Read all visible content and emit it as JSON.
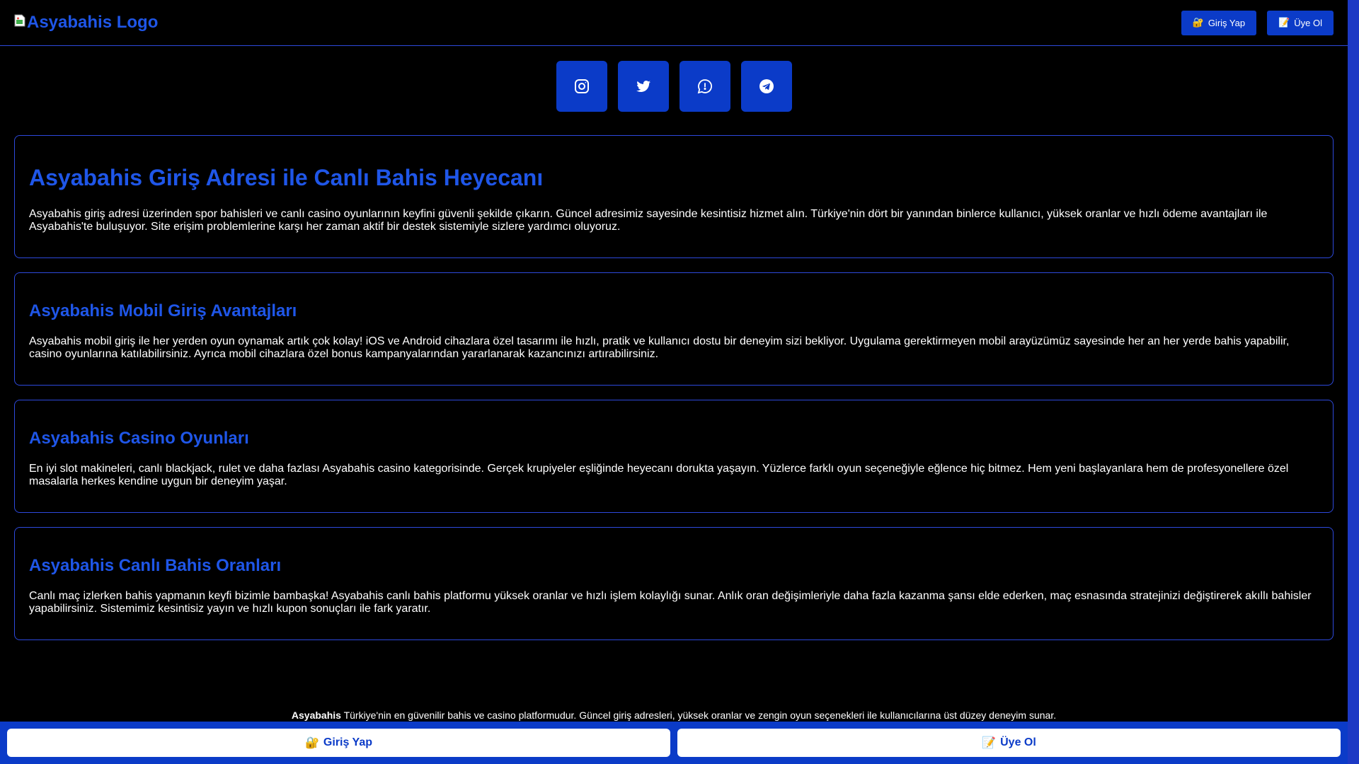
{
  "header": {
    "logo_alt": "Asyabahis Logo",
    "login_icon": "🔐",
    "login_label": "Giriş Yap",
    "register_icon": "📝",
    "register_label": "Üye Ol"
  },
  "social": [
    {
      "icon": "instagram-icon"
    },
    {
      "icon": "twitter-icon"
    },
    {
      "icon": "whatsapp-icon"
    },
    {
      "icon": "telegram-icon"
    }
  ],
  "sections": [
    {
      "title": "Asyabahis Giriş Adresi ile Canlı Bahis Heyecanı",
      "text": "Asyabahis giriş adresi üzerinden spor bahisleri ve canlı casino oyunlarının keyfini güvenli şekilde çıkarın. Güncel adresimiz sayesinde kesintisiz hizmet alın. Türkiye'nin dört bir yanından binlerce kullanıcı, yüksek oranlar ve hızlı ödeme avantajları ile Asyabahis'te buluşuyor. Site erişim problemlerine karşı her zaman aktif bir destek sistemiyle sizlere yardımcı oluyoruz."
    },
    {
      "title": "Asyabahis Mobil Giriş Avantajları",
      "text": "Asyabahis mobil giriş ile her yerden oyun oynamak artık çok kolay! iOS ve Android cihazlara özel tasarımı ile hızlı, pratik ve kullanıcı dostu bir deneyim sizi bekliyor. Uygulama gerektirmeyen mobil arayüzümüz sayesinde her an her yerde bahis yapabilir, casino oyunlarına katılabilirsiniz. Ayrıca mobil cihazlara özel bonus kampanyalarından yararlanarak kazancınızı artırabilirsiniz."
    },
    {
      "title": "Asyabahis Casino Oyunları",
      "text": "En iyi slot makineleri, canlı blackjack, rulet ve daha fazlası Asyabahis casino kategorisinde. Gerçek krupiyeler eşliğinde heyecanı dorukta yaşayın. Yüzlerce farklı oyun seçeneğiyle eğlence hiç bitmez. Hem yeni başlayanlara hem de profesyonellere özel masalarla herkes kendine uygun bir deneyim yaşar."
    },
    {
      "title": "Asyabahis Canlı Bahis Oranları",
      "text": "Canlı maç izlerken bahis yapmanın keyfi bizimle bambaşka! Asyabahis canlı bahis platformu yüksek oranlar ve hızlı işlem kolaylığı sunar. Anlık oran değişimleriyle daha fazla kazanma şansı elde ederken, maç esnasında stratejinizi değiştirerek akıllı bahisler yapabilirsiniz. Sistemimiz kesintisiz yayın ve hızlı kupon sonuçları ile fark yaratır."
    }
  ],
  "footer": {
    "brand": "Asyabahis",
    "text": " Türkiye'nin en güvenilir bahis ve casino platformudur. Güncel giriş adresleri, yüksek oranlar ve zengin oyun seçenekleri ile kullanıcılarına üst düzey deneyim sunar."
  },
  "bottom_bar": {
    "login_icon": "🔐",
    "login_label": "Giriş Yap",
    "register_icon": "📝",
    "register_label": "Üye Ol"
  },
  "colors": {
    "accent": "#0b3bc8",
    "heading": "#1f56e8",
    "border": "#2d49dc",
    "background": "#000000"
  }
}
